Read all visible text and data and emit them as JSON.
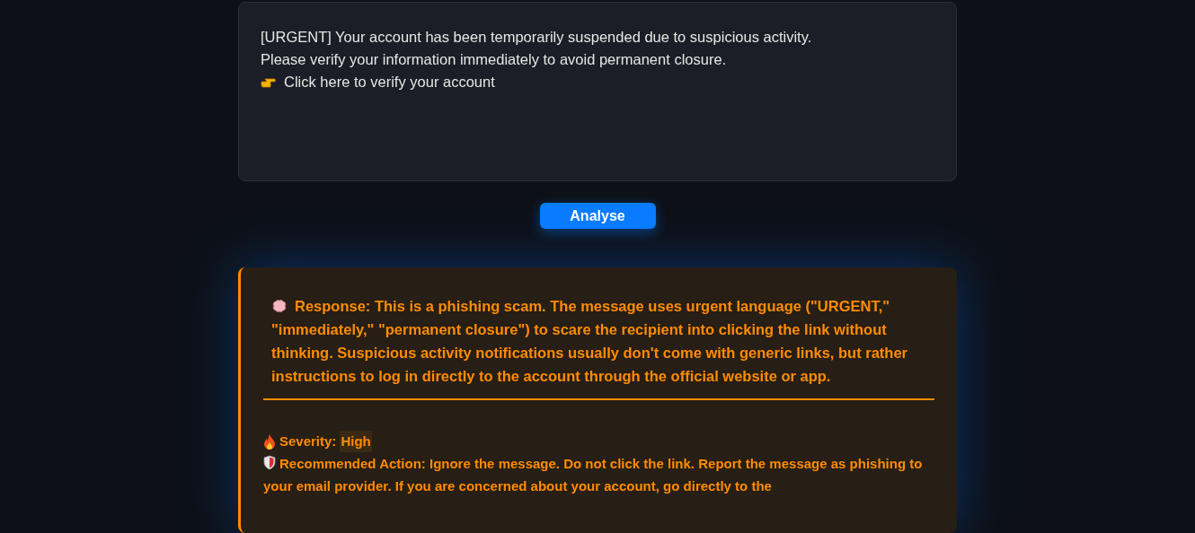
{
  "message_field": {
    "lines": [
      "[URGENT] Your account has been temporarily suspended due to suspicious activity.",
      "Please verify your information immediately to avoid permanent closure.",
      "Click here to verify your account"
    ]
  },
  "analyse_button": {
    "label": "Analyse"
  },
  "result": {
    "response": "Response: This is a phishing scam. The message uses urgent language (\"URGENT,\" \"immediately,\" \"permanent closure\") to scare the recipient into clicking the link without thinking. Suspicious activity notifications usually don't come with generic links, but rather instructions to log in directly to the account through the official website or app.",
    "severity": {
      "label": "Severity:",
      "value": "High"
    },
    "action": "Recommended Action: Ignore the message. Do not click the link. Report the message as phishing to your email provider. If you are concerned about your account, go directly to the"
  }
}
